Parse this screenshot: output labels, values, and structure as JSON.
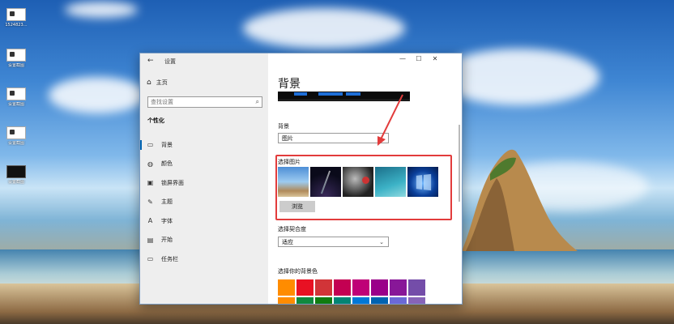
{
  "desktop": {
    "icons": [
      {
        "label": "1524823…",
        "style": "white"
      },
      {
        "label": "设置截图",
        "style": "white"
      },
      {
        "label": "设置截图",
        "style": "white"
      },
      {
        "label": "设置截图",
        "style": "white"
      },
      {
        "label": "设置截图",
        "style": "dark"
      }
    ]
  },
  "settings": {
    "app_title": "设置",
    "home_label": "主页",
    "search_placeholder": "查找设置",
    "section_heading": "个性化",
    "nav": [
      {
        "label": "背景",
        "icon": "background-icon",
        "glyph": "▭",
        "active": true
      },
      {
        "label": "颜色",
        "icon": "palette-icon",
        "glyph": "◍",
        "active": false
      },
      {
        "label": "锁屏界面",
        "icon": "lock-screen-icon",
        "glyph": "▣",
        "active": false
      },
      {
        "label": "主题",
        "icon": "theme-icon",
        "glyph": "✎",
        "active": false
      },
      {
        "label": "字体",
        "icon": "font-icon",
        "glyph": "A",
        "active": false
      },
      {
        "label": "开始",
        "icon": "start-icon",
        "glyph": "▤",
        "active": false
      },
      {
        "label": "任务栏",
        "icon": "taskbar-icon",
        "glyph": "▭",
        "active": false
      }
    ],
    "page_title": "背景",
    "background_label": "背景",
    "background_value": "图片",
    "choose_picture_label": "选择图片",
    "browse_button": "浏览",
    "fit_label": "选择契合度",
    "fit_value": "适应",
    "color_label": "选择你的背景色",
    "colors": [
      "#ff8c00",
      "#e81123",
      "#d13438",
      "#c30052",
      "#bf0077",
      "#9a0089",
      "#881798",
      "#744da9",
      "#ff8c00",
      "#10893e",
      "#107c10",
      "#018574",
      "#0078d7",
      "#0063b1",
      "#6b69d6",
      "#8764b8"
    ],
    "window_controls": {
      "minimize": "—",
      "maximize": "☐",
      "close": "✕"
    },
    "accent_color": "#0063b1",
    "annotation_color": "#e23c3c"
  }
}
